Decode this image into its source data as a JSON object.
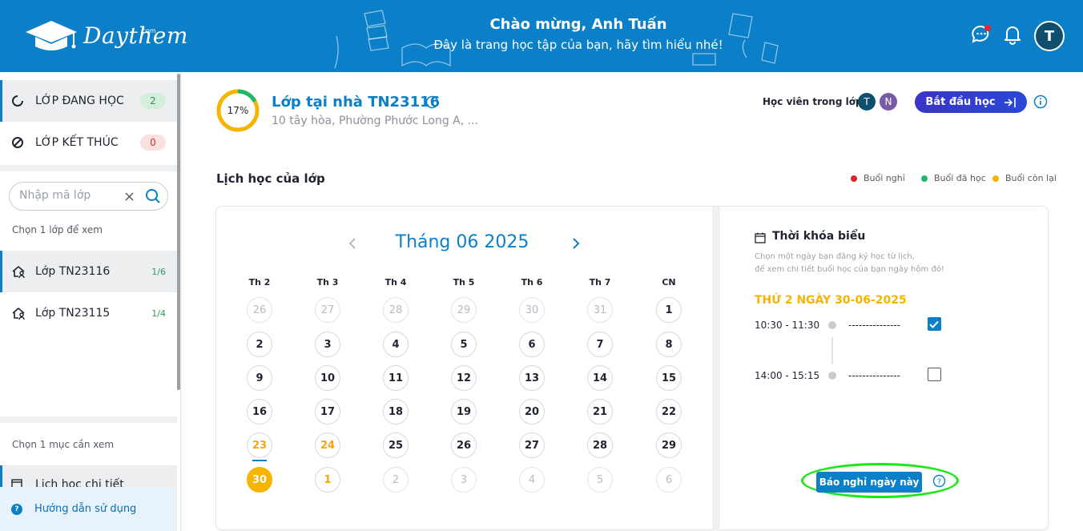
{
  "header": {
    "logo_text": "Daythem",
    "logo_sub": ".com",
    "welcome_title": "Chào mừng, Anh Tuấn",
    "welcome_sub": "Đây là trang học tập của bạn, hãy tìm hiểu nhé!",
    "avatar_initial": "T"
  },
  "sidebar": {
    "tabs": [
      {
        "label": "LỚP ĐANG HỌC",
        "count": "2"
      },
      {
        "label": "LỚP KẾT THÚC",
        "count": "0"
      }
    ],
    "search_placeholder": "Nhập mã lớp",
    "choose_class_hint": "Chọn 1 lớp để xem",
    "classes": [
      {
        "label": "Lớp TN23116",
        "progress": "1/6"
      },
      {
        "label": "Lớp TN23115",
        "progress": "1/4"
      }
    ],
    "choose_item_hint": "Chọn 1 mục cần xem",
    "menu_item": "Lịch học chi tiết",
    "help": "Hướng dẫn sử dụng"
  },
  "class_info": {
    "progress_text": "17%",
    "progress_value": 0.17,
    "title": "Lớp tại nhà TN23116",
    "address": "10 tây hòa, Phường Phước Long A, ...",
    "students_label": "Học viên trong lớp:",
    "students": [
      {
        "initial": "T",
        "color": "#0f4f6e"
      },
      {
        "initial": "N",
        "color": "#7a5aa6"
      }
    ],
    "start_button": "Bắt đầu học"
  },
  "schedule": {
    "title": "Lịch học của lớp",
    "legend": [
      {
        "label": "Buổi nghỉ",
        "color": "#d7262b"
      },
      {
        "label": "Buổi đã học",
        "color": "#1fb86b"
      },
      {
        "label": "Buổi còn lại",
        "color": "#f4b400"
      }
    ],
    "month_title": "Tháng 06 2025",
    "weekdays": [
      "Th 2",
      "Th 3",
      "Th 4",
      "Th 5",
      "Th 6",
      "Th 7",
      "CN"
    ],
    "weeks": [
      [
        "26",
        "27",
        "28",
        "29",
        "30",
        "31",
        "1"
      ],
      [
        "2",
        "3",
        "4",
        "5",
        "6",
        "7",
        "8"
      ],
      [
        "9",
        "10",
        "11",
        "12",
        "13",
        "14",
        "15"
      ],
      [
        "16",
        "17",
        "18",
        "19",
        "20",
        "21",
        "22"
      ],
      [
        "23",
        "24",
        "25",
        "26",
        "27",
        "28",
        "29"
      ],
      [
        "30",
        "1",
        "2",
        "3",
        "4",
        "5",
        "6"
      ]
    ]
  },
  "timetable": {
    "title": "Thời khóa biểu",
    "desc_line1": "Chọn một ngày bạn đăng ký học từ lịch,",
    "desc_line2": "để xem chi tiết buổi học của bạn ngày hôm đó!",
    "date_label": "THỨ 2 NGÀY 30-06-2025",
    "slots": [
      {
        "time": "10:30 - 11:30",
        "dash": "---------------",
        "checked": true
      },
      {
        "time": "14:00 - 15:15",
        "dash": "---------------",
        "checked": false
      }
    ],
    "report_button": "Báo nghỉ ngày này"
  },
  "colors": {
    "brand_blue": "#0b7fc7",
    "accent_orange": "#f4b400",
    "highlight_green": "#1ee619"
  }
}
